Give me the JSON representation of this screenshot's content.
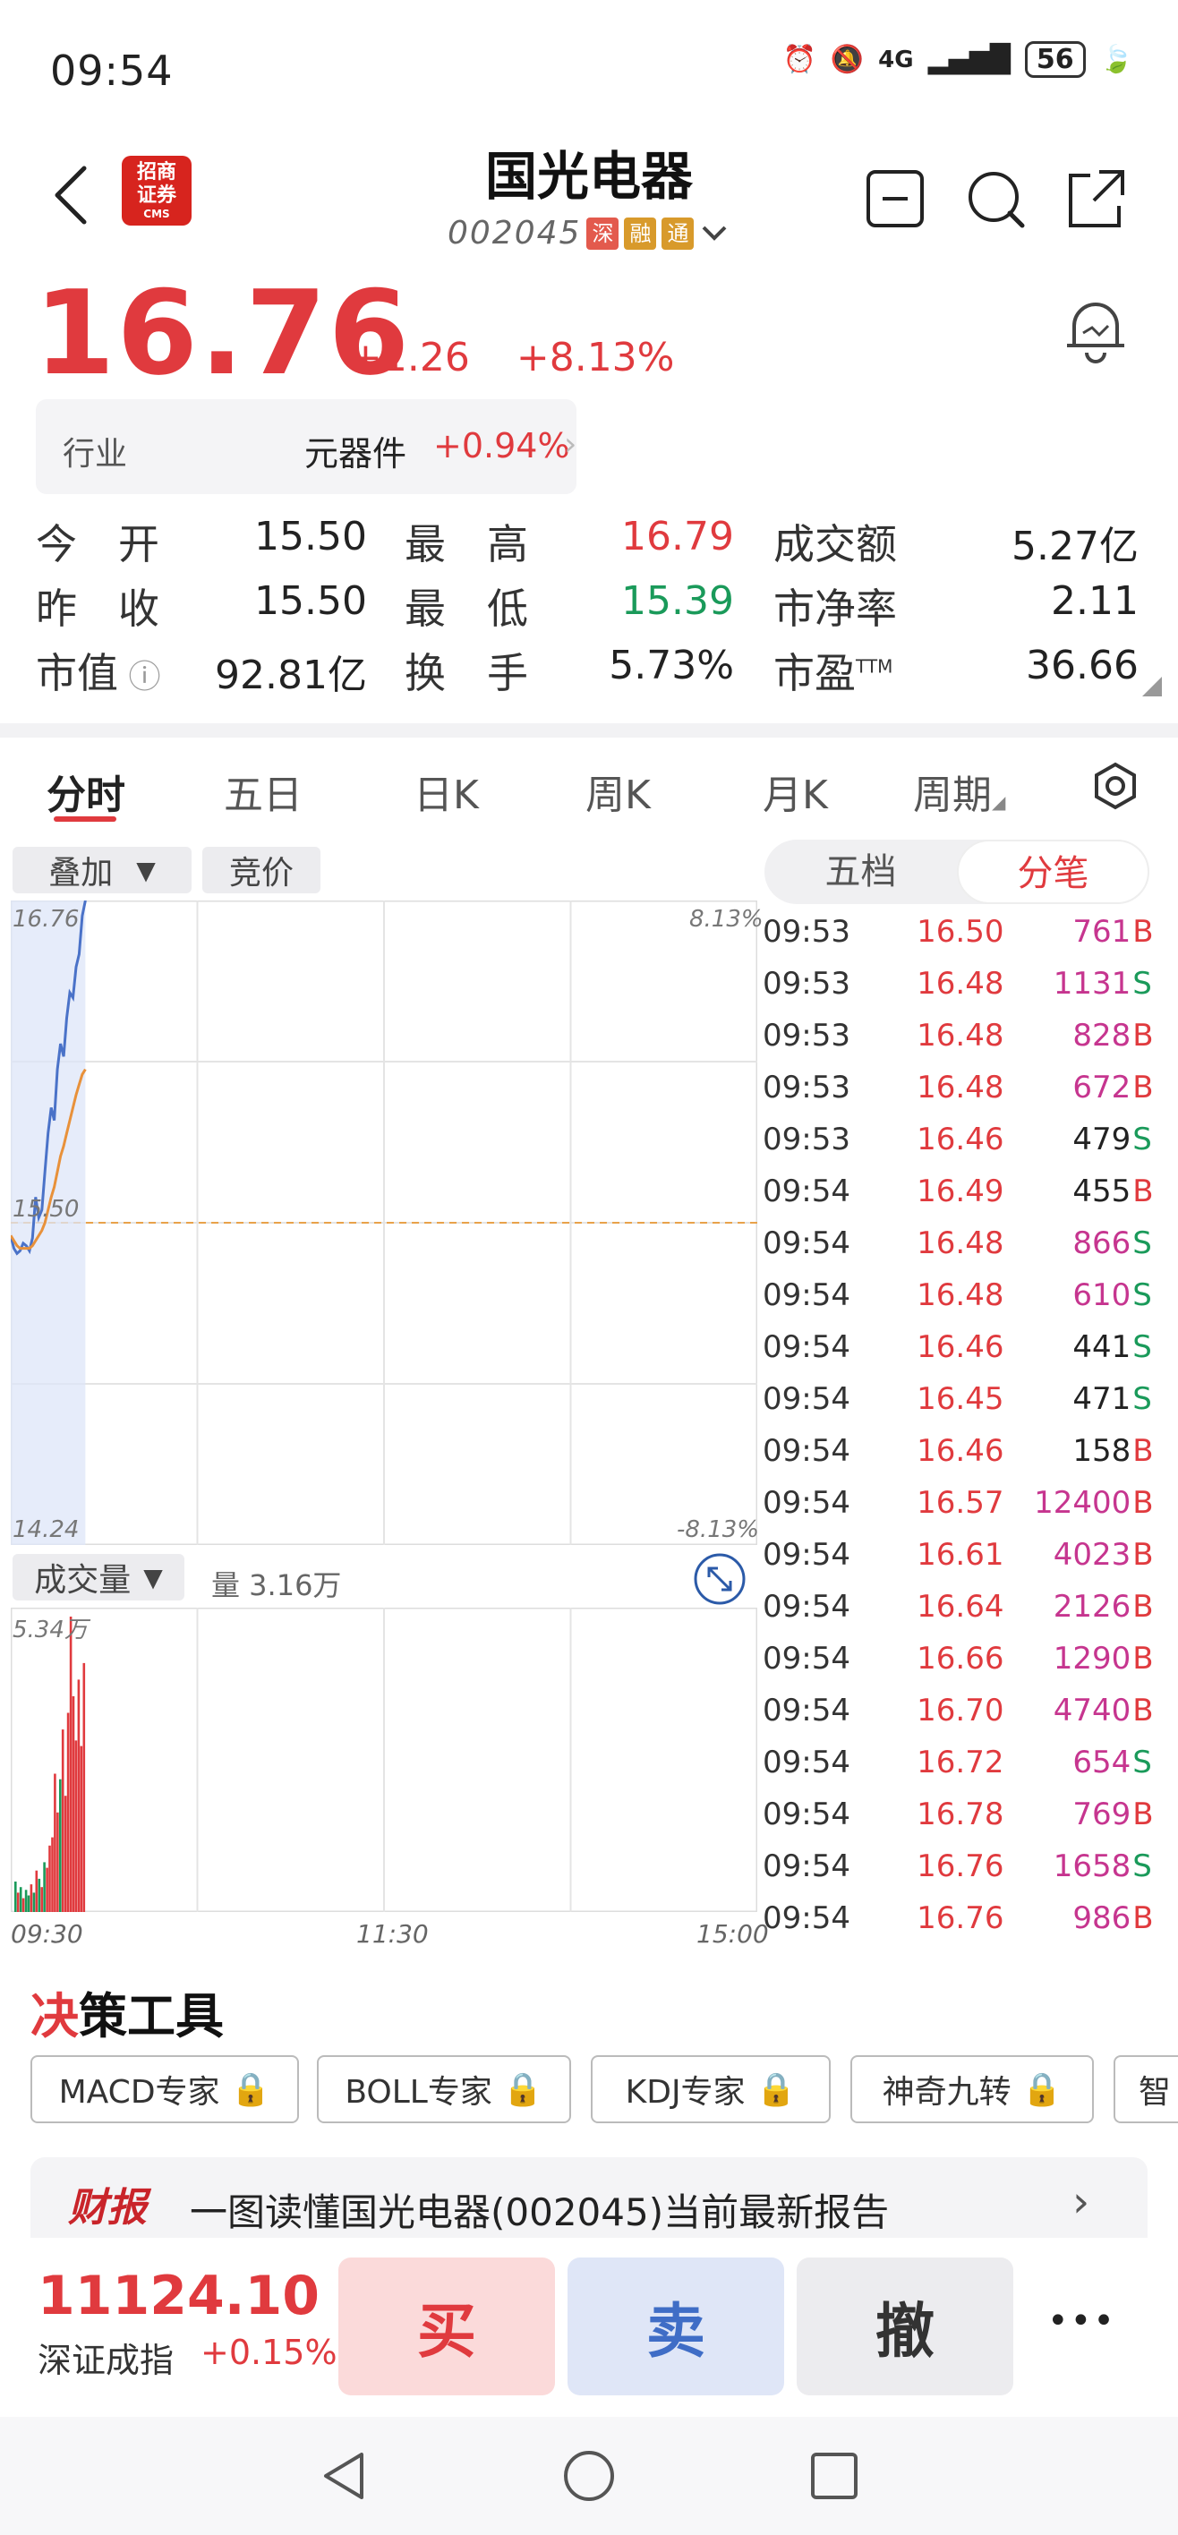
{
  "status_bar": {
    "time": "09:54",
    "network": "4G",
    "battery": "56"
  },
  "header": {
    "logo_lines": [
      "招商",
      "证券",
      "CMS"
    ],
    "stock_name": "国光电器",
    "stock_code": "002045",
    "tags": [
      {
        "text": "深",
        "color": "#e35a4d"
      },
      {
        "text": "融",
        "color": "#d89a2b"
      },
      {
        "text": "通",
        "color": "#d89a2b"
      }
    ]
  },
  "quote": {
    "price": "16.76",
    "change": "+1.26",
    "change_pct": "+8.13%",
    "industry_label": "行业",
    "industry_name": "元器件",
    "industry_pct": "+0.94%"
  },
  "stats": [
    {
      "label": "今　开",
      "value": "15.50",
      "label2": "最　高",
      "value2": "16.79",
      "value2_color": "#e03a3e",
      "label3": "成交额",
      "value3": "5.27亿"
    },
    {
      "label": "昨　收",
      "value": "15.50",
      "label2": "最　低",
      "value2": "15.39",
      "value2_color": "#1a9a5a",
      "label3": "市净率",
      "value3": "2.11"
    },
    {
      "label": "市值",
      "value": "92.81亿",
      "label2": "换　手",
      "value2": "5.73%",
      "value2_color": "#222222",
      "label3": "市盈TTM",
      "value3": "36.66"
    }
  ],
  "tabs": [
    "分时",
    "五日",
    "日K",
    "周K",
    "月K",
    "周期"
  ],
  "chart_controls": {
    "overlay": "叠加",
    "auction": "竞价",
    "volume_label": "成交量",
    "volume_value": "量 3.16万"
  },
  "segment": {
    "option1": "五档",
    "option2": "分笔"
  },
  "chart_data": {
    "type": "line",
    "title": "",
    "price_axis": {
      "max": "16.76",
      "mid": "15.50",
      "min": "14.24",
      "max_pct": "8.13%",
      "min_pct": "-8.13%"
    },
    "volume_axis": {
      "max": "5.34万"
    },
    "time_labels": [
      "09:30",
      "11:30",
      "15:00"
    ],
    "ylim": [
      14.24,
      16.76
    ],
    "x_range_minutes": [
      0,
      240
    ],
    "series": [
      {
        "color": "#4a72c8",
        "x": [
          0,
          1,
          2,
          3,
          4,
          5,
          6,
          7,
          8,
          9,
          10,
          11,
          12,
          13,
          14,
          15,
          16,
          17,
          18,
          19,
          20,
          21,
          22,
          23,
          24
        ],
        "y": [
          15.45,
          15.4,
          15.38,
          15.39,
          15.42,
          15.41,
          15.39,
          15.44,
          15.6,
          15.52,
          15.55,
          15.7,
          15.85,
          15.95,
          15.9,
          16.1,
          16.2,
          16.15,
          16.3,
          16.4,
          16.38,
          16.5,
          16.55,
          16.7,
          16.76
        ]
      },
      {
        "color": "#e8913a",
        "x": [
          0,
          1,
          2,
          3,
          4,
          5,
          6,
          7,
          8,
          9,
          10,
          11,
          12,
          13,
          14,
          15,
          16,
          17,
          18,
          19,
          20,
          21,
          22,
          23,
          24
        ],
        "y": [
          15.45,
          15.43,
          15.41,
          15.4,
          15.4,
          15.4,
          15.4,
          15.41,
          15.43,
          15.45,
          15.47,
          15.5,
          15.55,
          15.6,
          15.64,
          15.7,
          15.76,
          15.8,
          15.85,
          15.9,
          15.95,
          16.0,
          16.04,
          16.08,
          16.1
        ]
      }
    ],
    "volume_bars": [
      {
        "v": 0.55,
        "c": "#1a9a5a"
      },
      {
        "v": 0.35,
        "c": "#e03a3e"
      },
      {
        "v": 0.45,
        "c": "#1a9a5a"
      },
      {
        "v": 0.25,
        "c": "#e03a3e"
      },
      {
        "v": 0.4,
        "c": "#1a9a5a"
      },
      {
        "v": 0.3,
        "c": "#1a9a5a"
      },
      {
        "v": 0.5,
        "c": "#e03a3e"
      },
      {
        "v": 0.35,
        "c": "#1a9a5a"
      },
      {
        "v": 0.75,
        "c": "#e03a3e"
      },
      {
        "v": 0.6,
        "c": "#1a9a5a"
      },
      {
        "v": 0.45,
        "c": "#e03a3e"
      },
      {
        "v": 0.9,
        "c": "#1a9a5a"
      },
      {
        "v": 0.8,
        "c": "#e03a3e"
      },
      {
        "v": 1.2,
        "c": "#e03a3e"
      },
      {
        "v": 1.35,
        "c": "#e03a3e"
      },
      {
        "v": 2.5,
        "c": "#e03a3e"
      },
      {
        "v": 1.8,
        "c": "#e03a3e"
      },
      {
        "v": 2.4,
        "c": "#1a9a5a"
      },
      {
        "v": 3.3,
        "c": "#e03a3e"
      },
      {
        "v": 2.1,
        "c": "#e03a3e"
      },
      {
        "v": 3.6,
        "c": "#e03a3e"
      },
      {
        "v": 5.34,
        "c": "#e03a3e"
      },
      {
        "v": 3.9,
        "c": "#e03a3e"
      },
      {
        "v": 3.1,
        "c": "#e03a3e"
      },
      {
        "v": 4.2,
        "c": "#e03a3e"
      },
      {
        "v": 3.0,
        "c": "#e03a3e"
      },
      {
        "v": 4.5,
        "c": "#e03a3e"
      }
    ]
  },
  "ticks": [
    {
      "time": "09:53",
      "price": "16.50",
      "vol": "761",
      "side": "B"
    },
    {
      "time": "09:53",
      "price": "16.48",
      "vol": "1131",
      "side": "S"
    },
    {
      "time": "09:53",
      "price": "16.48",
      "vol": "828",
      "side": "B"
    },
    {
      "time": "09:53",
      "price": "16.48",
      "vol": "672",
      "side": "B"
    },
    {
      "time": "09:53",
      "price": "16.46",
      "vol": "479",
      "side": "S"
    },
    {
      "time": "09:54",
      "price": "16.49",
      "vol": "455",
      "side": "B"
    },
    {
      "time": "09:54",
      "price": "16.48",
      "vol": "866",
      "side": "S"
    },
    {
      "time": "09:54",
      "price": "16.48",
      "vol": "610",
      "side": "S"
    },
    {
      "time": "09:54",
      "price": "16.46",
      "vol": "441",
      "side": "S"
    },
    {
      "time": "09:54",
      "price": "16.45",
      "vol": "471",
      "side": "S"
    },
    {
      "time": "09:54",
      "price": "16.46",
      "vol": "158",
      "side": "B"
    },
    {
      "time": "09:54",
      "price": "16.57",
      "vol": "12400",
      "side": "B"
    },
    {
      "time": "09:54",
      "price": "16.61",
      "vol": "4023",
      "side": "B"
    },
    {
      "time": "09:54",
      "price": "16.64",
      "vol": "2126",
      "side": "B"
    },
    {
      "time": "09:54",
      "price": "16.66",
      "vol": "1290",
      "side": "B"
    },
    {
      "time": "09:54",
      "price": "16.70",
      "vol": "4740",
      "side": "B"
    },
    {
      "time": "09:54",
      "price": "16.72",
      "vol": "654",
      "side": "S"
    },
    {
      "time": "09:54",
      "price": "16.78",
      "vol": "769",
      "side": "B"
    },
    {
      "time": "09:54",
      "price": "16.76",
      "vol": "1658",
      "side": "S"
    },
    {
      "time": "09:54",
      "price": "16.76",
      "vol": "986",
      "side": "B"
    }
  ],
  "tools_section": {
    "title": "决策工具",
    "tools": [
      "MACD专家",
      "BOLL专家",
      "KDJ专家",
      "神奇九转",
      "智"
    ]
  },
  "report": {
    "badge": "财报",
    "text": "一图读懂国光电器(002045)当前最新报告"
  },
  "bottom_bar": {
    "index_value": "11124.10",
    "index_name": "深证成指",
    "index_pct": "+0.15%",
    "buy": "买",
    "sell": "卖",
    "cancel": "撤",
    "more": "•••"
  },
  "colors": {
    "up": "#e03a3e",
    "down": "#1a9a5a",
    "accent": "#e03a3e",
    "buy_bg": "#fbdada",
    "sell_bg": "#dfe6f7",
    "cancel_bg": "#ececef",
    "vol_magenta": "#c6358f"
  }
}
